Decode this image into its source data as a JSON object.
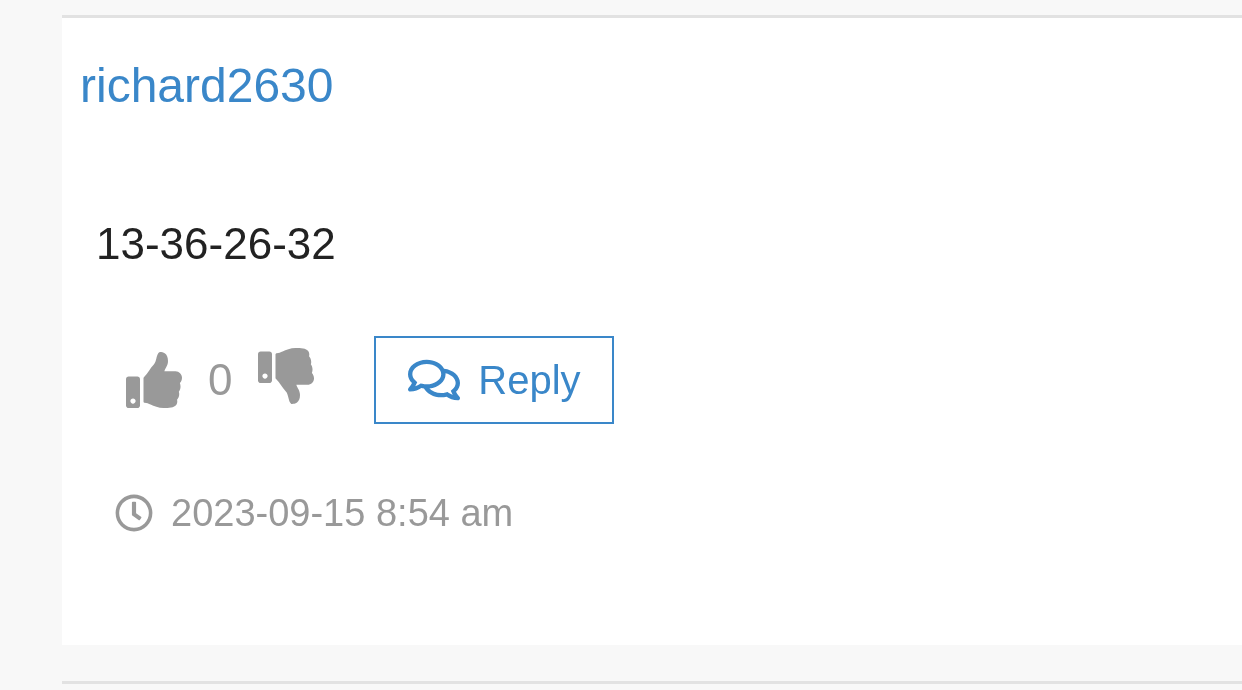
{
  "comment": {
    "author": "richard2630",
    "body": "13-36-26-32",
    "votes": {
      "count": "0"
    },
    "reply_button": "Reply",
    "timestamp": "2023-09-15 8:54 am"
  }
}
